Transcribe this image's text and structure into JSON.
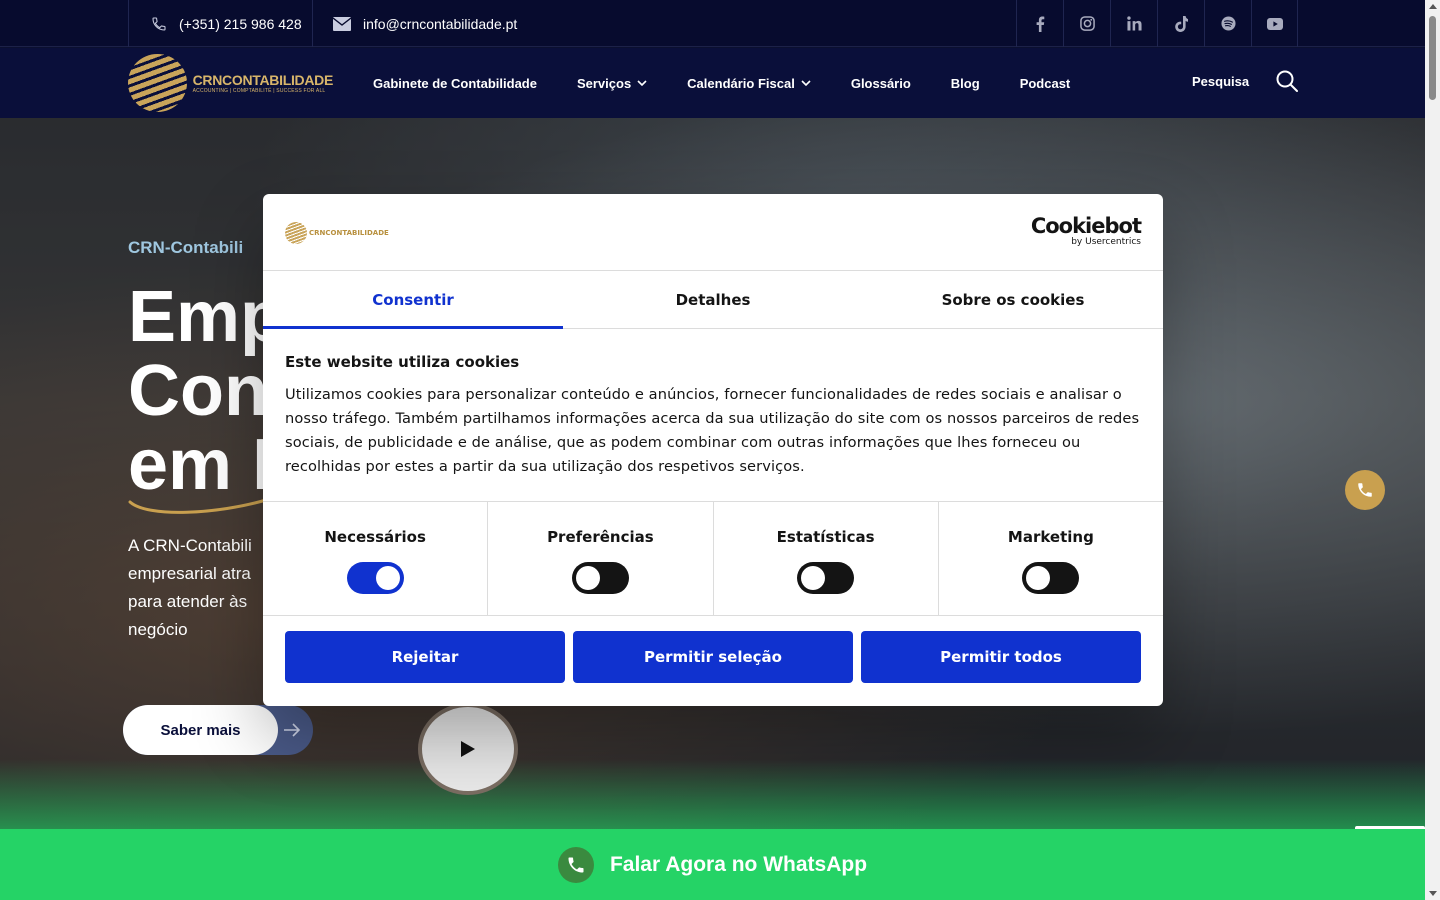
{
  "topbar": {
    "phone": "(+351) 215 986 428",
    "email": "info@crncontabilidade.pt",
    "socials": [
      "facebook-icon",
      "instagram-icon",
      "linkedin-icon",
      "tiktok-icon",
      "spotify-icon",
      "youtube-icon"
    ]
  },
  "nav": {
    "logo_text": "CRNCONTABILIDADE",
    "logo_tagline": "ACCOUNTING | COMPTABILITÉ | SUCCESS FOR ALL",
    "items": [
      {
        "label": "Gabinete de Contabilidade",
        "dropdown": false
      },
      {
        "label": "Serviços",
        "dropdown": true
      },
      {
        "label": "Calendário Fiscal",
        "dropdown": true
      },
      {
        "label": "Glossário",
        "dropdown": false
      },
      {
        "label": "Blog",
        "dropdown": false
      },
      {
        "label": "Podcast",
        "dropdown": false
      }
    ],
    "search_label": "Pesquisa"
  },
  "hero": {
    "eyebrow": "CRN-Contabili",
    "headline_1": "Emp",
    "headline_2": "Con",
    "headline_3": "em I",
    "paragraph_1": "A CRN-Contabili",
    "paragraph_2": "empresarial atra",
    "paragraph_3": "para atender às",
    "paragraph_4": "negócio",
    "cta_label": "Saber mais"
  },
  "whatsapp": {
    "label": "Falar Agora no WhatsApp"
  },
  "cookie_dialog": {
    "logo_text": "CRNCONTABILIDADE",
    "brand": "Cookiebot",
    "brand_sub": "by Usercentrics",
    "tabs": [
      {
        "label": "Consentir",
        "active": true
      },
      {
        "label": "Detalhes",
        "active": false
      },
      {
        "label": "Sobre os cookies",
        "active": false
      }
    ],
    "heading": "Este website utiliza cookies",
    "body": "Utilizamos cookies para personalizar conteúdo e anúncios, fornecer funcionalidades de redes sociais e analisar o nosso tráfego. Também partilhamos informações acerca da sua utilização do site com os nossos parceiros de redes sociais, de publicidade e de análise, que as podem combinar com outras informações que lhes forneceu ou recolhidas por estes a partir da sua utilização dos respetivos serviços.",
    "toggles": [
      {
        "label": "Necessários",
        "on": true
      },
      {
        "label": "Preferências",
        "on": false
      },
      {
        "label": "Estatísticas",
        "on": false
      },
      {
        "label": "Marketing",
        "on": false
      }
    ],
    "buttons": [
      "Rejeitar",
      "Permitir seleção",
      "Permitir todos"
    ]
  },
  "colors": {
    "navy": "#0a0f3a",
    "gold": "#c9a04f",
    "cookie_blue": "#1032cf",
    "whatsapp_green": "#25d366"
  }
}
